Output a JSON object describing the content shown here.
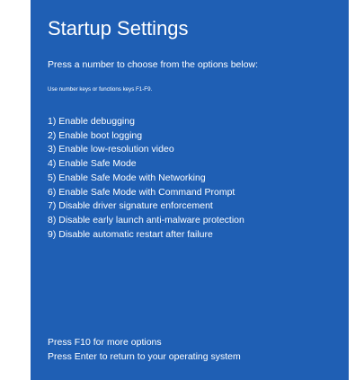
{
  "screen": {
    "background_color": "#1f5fb4",
    "text_color": "#ffffff",
    "title": "Startup Settings",
    "subtitle": "Press a number to choose from the options below:",
    "hint": "Use number keys or functions keys F1-F9."
  },
  "options": [
    "1) Enable debugging",
    "2) Enable boot logging",
    "3) Enable low-resolution video",
    "4) Enable Safe Mode",
    "5) Enable Safe Mode with Networking",
    "6) Enable Safe Mode with Command Prompt",
    "7) Disable driver signature enforcement",
    "8) Disable early launch anti-malware protection",
    "9) Disable automatic restart after failure"
  ],
  "footer": {
    "more_options": "Press F10 for more options",
    "return": "Press Enter to return to your operating system"
  }
}
